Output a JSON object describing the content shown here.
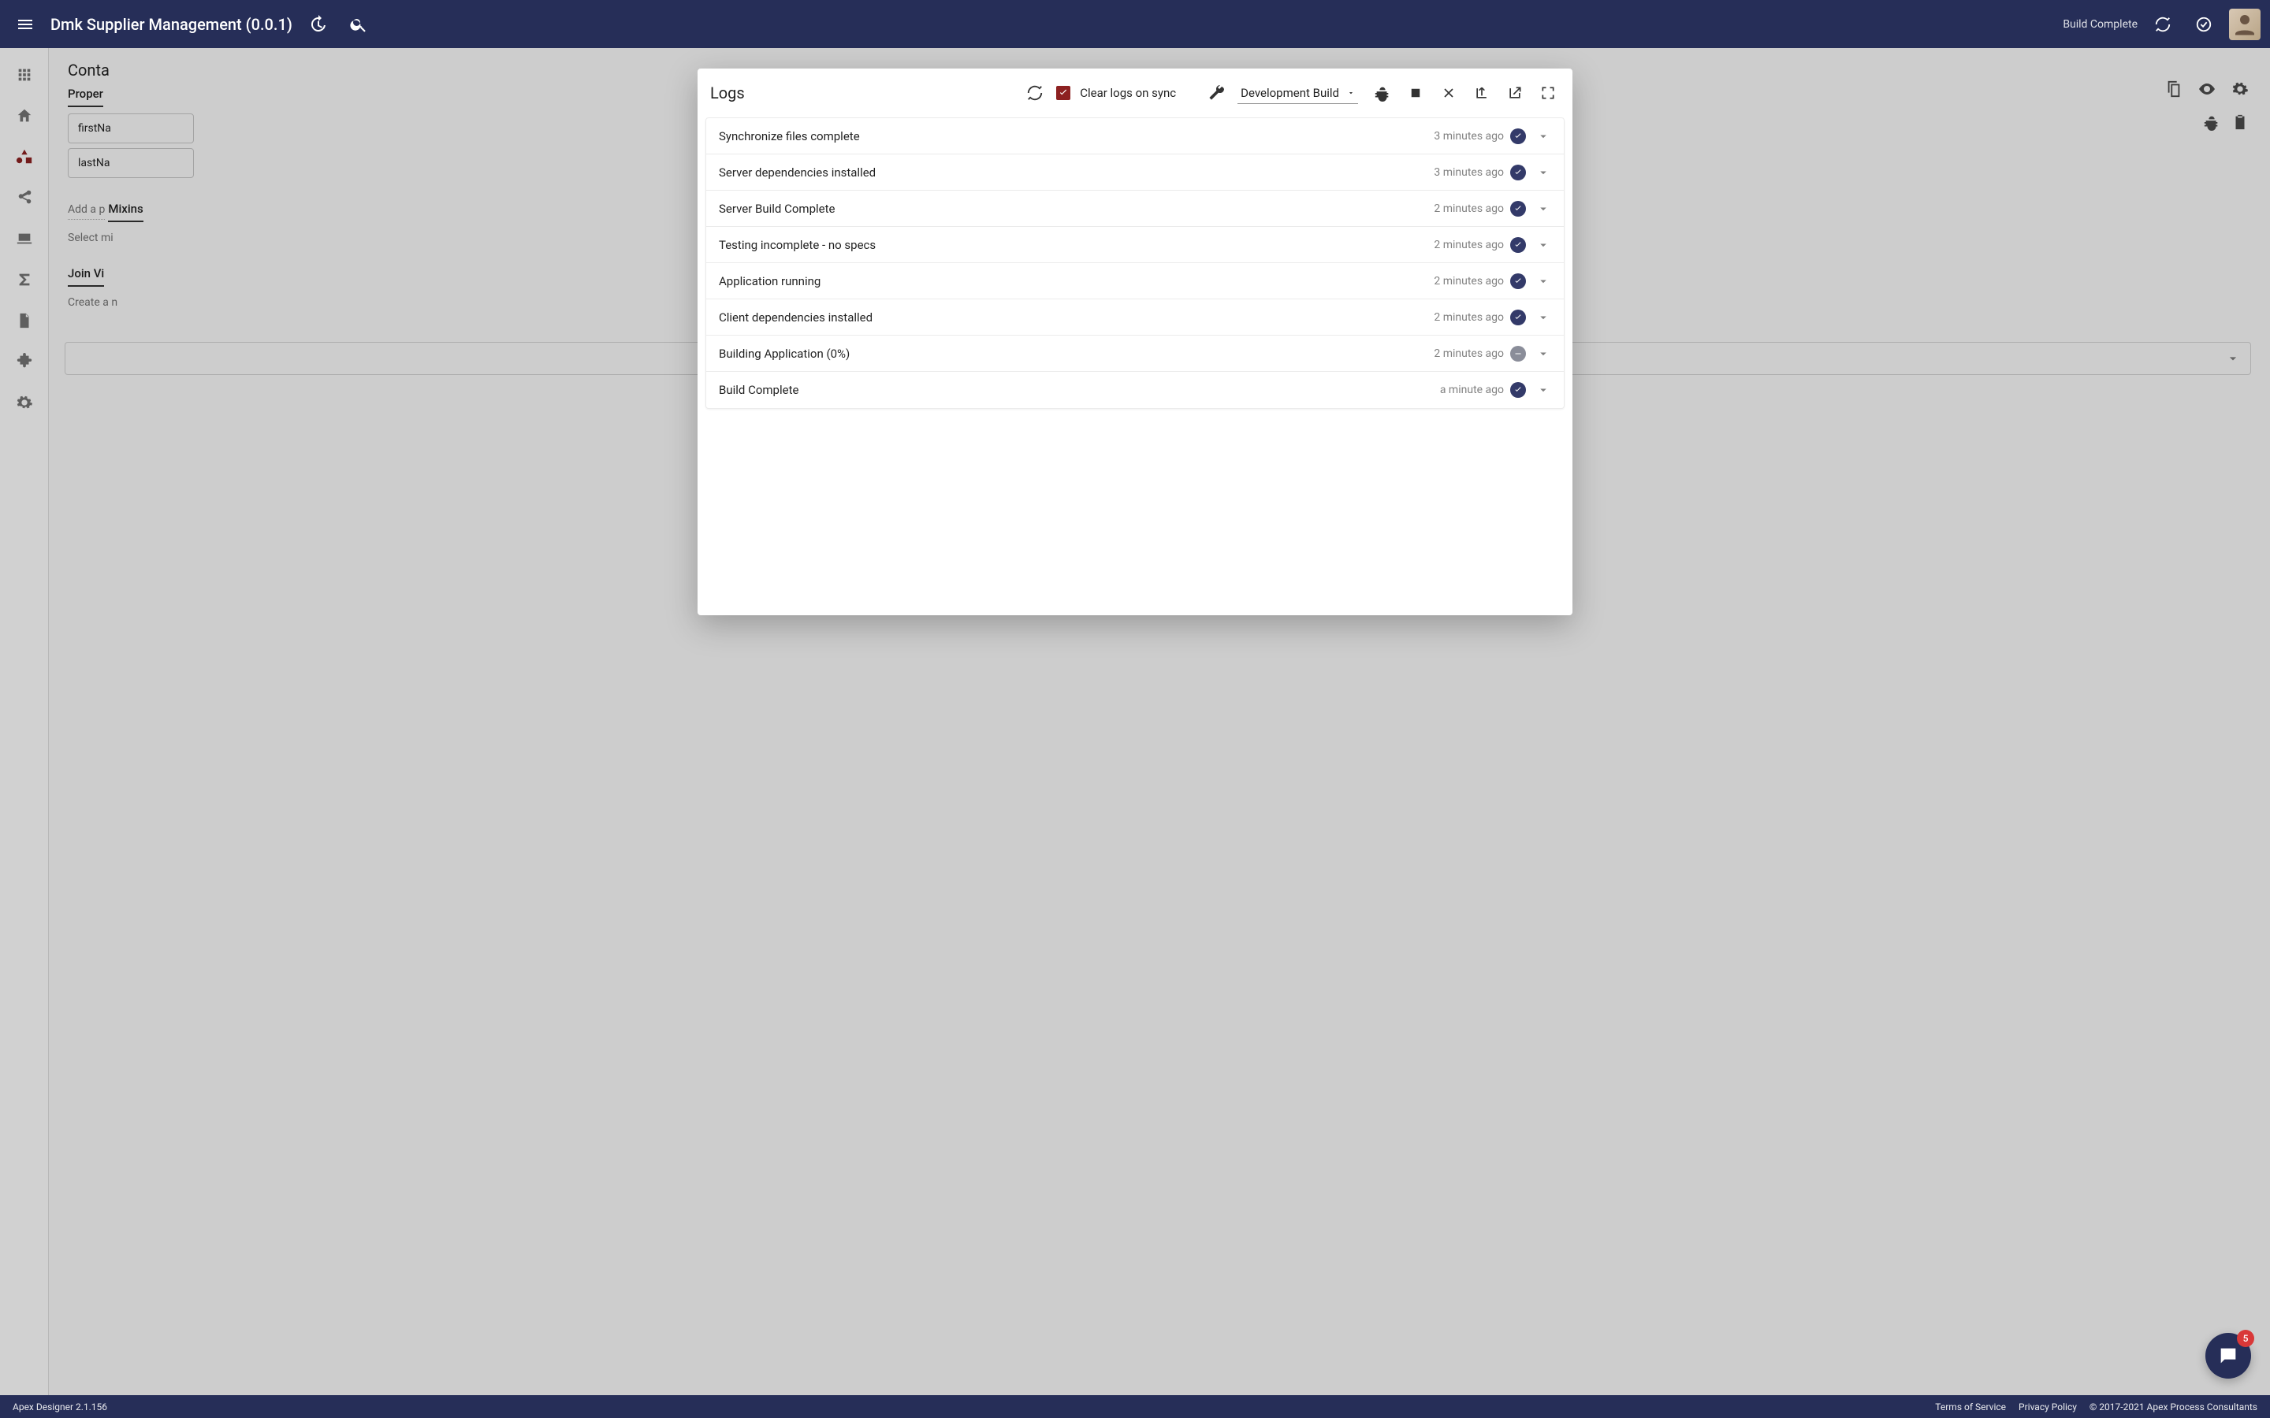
{
  "header": {
    "title": "Dmk Supplier Management (0.0.1)",
    "status": "Build Complete"
  },
  "sidebar": {
    "items": [
      {
        "name": "apps"
      },
      {
        "name": "home"
      },
      {
        "name": "shapes"
      },
      {
        "name": "share"
      },
      {
        "name": "laptop"
      },
      {
        "name": "sigma"
      },
      {
        "name": "file"
      },
      {
        "name": "plugin"
      },
      {
        "name": "settings"
      }
    ]
  },
  "main": {
    "page_title": "Conta",
    "sections": {
      "properties_label": "Proper",
      "mixins_label": "Mixins",
      "join_label": "Join Vi",
      "add_prop": "Add a p",
      "select_mixin": "Select mi",
      "create_new": "Create a n"
    },
    "properties": [
      {
        "name": "firstNa"
      },
      {
        "name": "lastNa"
      }
    ]
  },
  "logs_modal": {
    "title": "Logs",
    "clear_on_sync_label": "Clear logs on sync",
    "build_select": "Development Build",
    "entries": [
      {
        "message": "Synchronize files complete",
        "time": "3 minutes ago",
        "status": "ok"
      },
      {
        "message": "Server dependencies installed",
        "time": "3 minutes ago",
        "status": "ok"
      },
      {
        "message": "Server Build Complete",
        "time": "2 minutes ago",
        "status": "ok"
      },
      {
        "message": "Testing incomplete - no specs",
        "time": "2 minutes ago",
        "status": "ok"
      },
      {
        "message": "Application running",
        "time": "2 minutes ago",
        "status": "ok"
      },
      {
        "message": "Client dependencies installed",
        "time": "2 minutes ago",
        "status": "ok"
      },
      {
        "message": "Building Application (0%)",
        "time": "2 minutes ago",
        "status": "neutral"
      },
      {
        "message": "Build Complete",
        "time": "a minute ago",
        "status": "ok"
      }
    ]
  },
  "chat": {
    "badge": "5"
  },
  "footer": {
    "version": "Apex Designer 2.1.156",
    "links": {
      "tos": "Terms of Service",
      "privacy": "Privacy Policy",
      "copyright": "© 2017-2021 Apex Process Consultants"
    }
  }
}
